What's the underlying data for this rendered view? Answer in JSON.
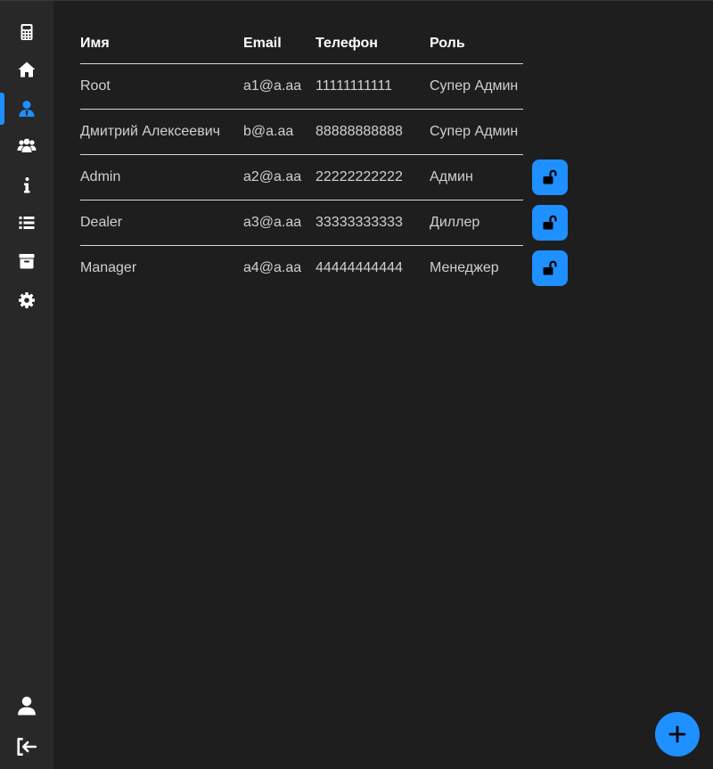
{
  "sidebar": {
    "items": [
      {
        "icon": "calculator-icon"
      },
      {
        "icon": "home-icon"
      },
      {
        "icon": "user-tie-icon",
        "active": true
      },
      {
        "icon": "users-icon"
      },
      {
        "icon": "info-icon"
      },
      {
        "icon": "list-icon"
      },
      {
        "icon": "archive-icon"
      },
      {
        "icon": "gear-icon"
      }
    ],
    "bottom": [
      {
        "icon": "profile-icon"
      },
      {
        "icon": "logout-icon"
      }
    ]
  },
  "table": {
    "headers": {
      "name": "Имя",
      "email": "Email",
      "phone": "Телефон",
      "role": "Роль"
    },
    "rows": [
      {
        "name": "Root",
        "email": "a1@a.aa",
        "phone": "11111111111",
        "role": "Супер Админ",
        "lock": false
      },
      {
        "name": "Дмитрий Алексеевич",
        "email": "b@a.aa",
        "phone": "88888888888",
        "role": "Супер Админ",
        "lock": false
      },
      {
        "name": "Admin",
        "email": "a2@a.aa",
        "phone": "22222222222",
        "role": "Админ",
        "lock": true
      },
      {
        "name": "Dealer",
        "email": "a3@a.aa",
        "phone": "33333333333",
        "role": "Диллер",
        "lock": true
      },
      {
        "name": "Manager",
        "email": "a4@a.aa",
        "phone": "44444444444",
        "role": "Менеджер",
        "lock": true
      }
    ]
  },
  "fab": {
    "icon": "plus-icon"
  },
  "colors": {
    "accent": "#1e90ff",
    "background": "#1e1e1e",
    "sidebar": "#282828",
    "text": "#d0d0d0",
    "header_text": "#ffffff"
  }
}
